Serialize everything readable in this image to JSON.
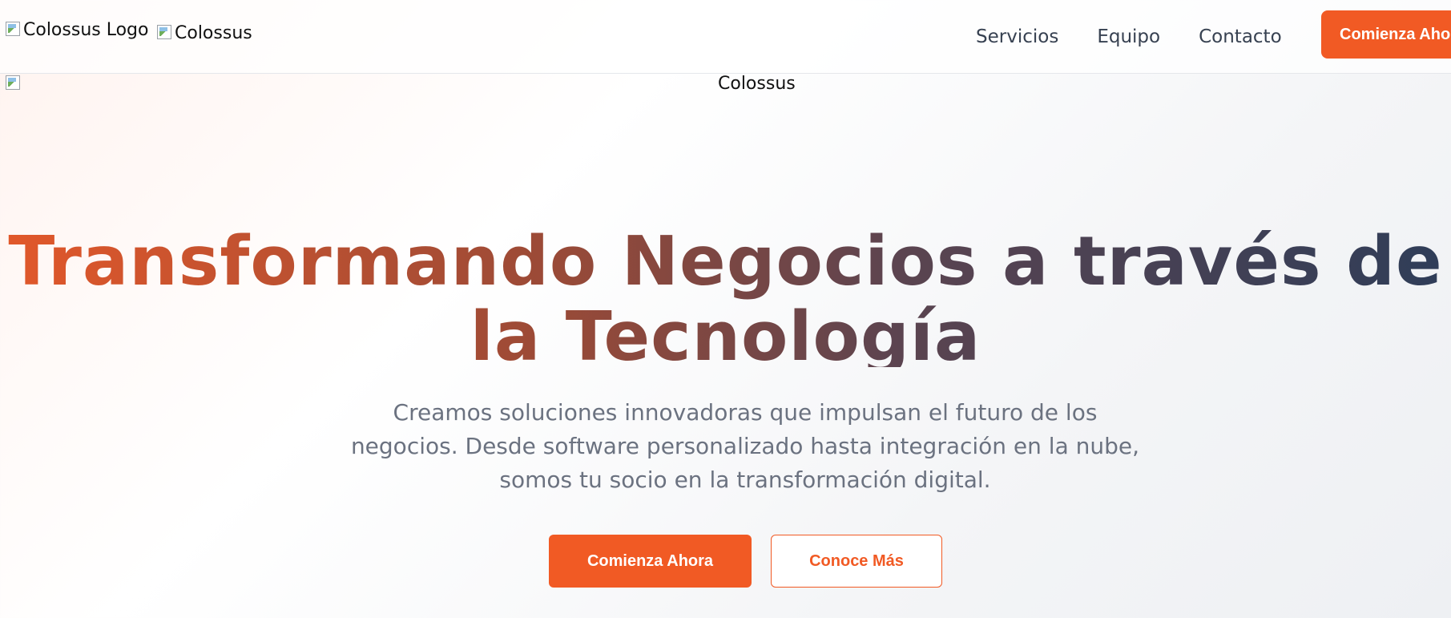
{
  "navbar": {
    "logo_alt": "Colossus Logo",
    "brand_alt": "Colossus",
    "links": [
      {
        "label": "Servicios"
      },
      {
        "label": "Equipo"
      },
      {
        "label": "Contacto"
      }
    ],
    "cta_label": "Comienza Ahora"
  },
  "hero": {
    "image_alt": "Colossus",
    "title": "Transformando Negocios a través de la Tecnología",
    "subtitle": "Creamos soluciones innovadoras que impulsan el futuro de los negocios. Desde software personalizado hasta integración en la nube, somos tu socio en la transformación digital.",
    "primary_button": "Comienza Ahora",
    "secondary_button": "Conoce Más"
  },
  "colors": {
    "accent": "#f15a24",
    "title_gradient_start": "#e2582a",
    "title_gradient_end": "#2f3d58"
  }
}
